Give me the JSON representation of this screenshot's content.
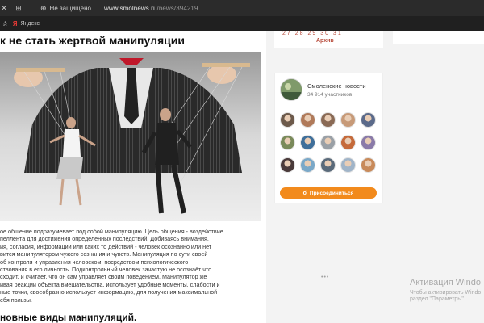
{
  "browser": {
    "security_label": "Не защищено",
    "url_host": "www.smolnews.ru",
    "url_path": "/news/394219",
    "bookmark": "Яндекс"
  },
  "article": {
    "title": "к не стать жертвой манипуляции",
    "paragraph_lines": [
      "ое общение подразумевает под собой манипуляцию. Цель общения - воздействие",
      "пеллента для достижения определенных последствий. Добиваясь внимания,",
      "ия, согласия, информации или каких то действий - человек осознанно или нет",
      "вится манипулятором чужого сознания и чувств. Манипуляция по сути своей",
      "об контроля и управления человеком, посредством психологического",
      "ствования в его личность. Подконтрольный человек зачастую не осознаёт что",
      "сходит, и считает, что он сам управляет своим поведением. Манипулятор же",
      "ивая реакции объекта вмешательства, использует удобные моменты, слабости и",
      "ные точки, своеобразно использует информацию, для получения максимальной",
      "ебя пользы."
    ],
    "subheading": "новные виды манипуляций."
  },
  "sidebar": {
    "calendar_row": "27  28  29  30  31",
    "archive_label": "Архив"
  },
  "ok_widget": {
    "group_name": "Смоленские новости",
    "members": "34 914 участников",
    "join_label": "Присоединиться",
    "avatar_colors": [
      "#6d5a4b",
      "#b07a5a",
      "#8a6a55",
      "#c79a78",
      "#5b6a8a",
      "#7a8a5a",
      "#3f6f9a",
      "#9aa0a6",
      "#c56a3a",
      "#8a7aa8",
      "#4a3a3a",
      "#7aa8c8",
      "#5a6a7a",
      "#a0b4c8",
      "#c88a5a"
    ]
  },
  "dots": "•••",
  "windows_activation": {
    "title": "Активация Windo",
    "line1": "Чтобы активировать Windo",
    "line2": "раздел \"Параметры\"."
  }
}
